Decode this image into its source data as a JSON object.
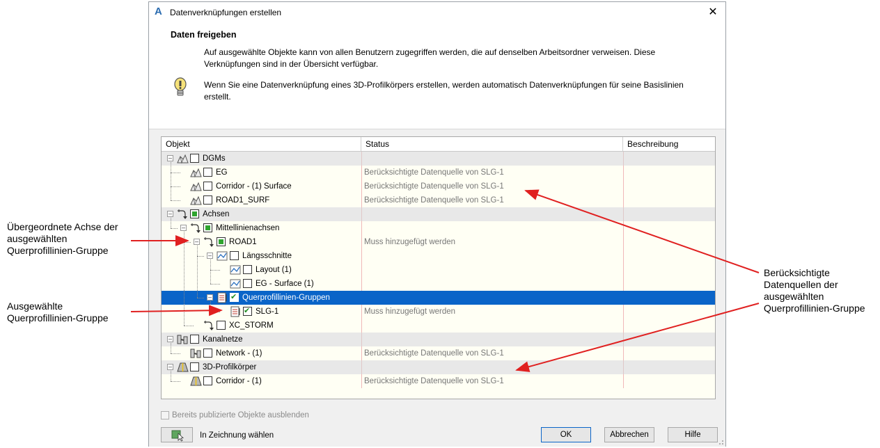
{
  "dialog": {
    "title": "Datenverknüpfungen erstellen",
    "section_title": "Daten freigeben",
    "description": "Auf ausgewählte Objekte kann von allen Benutzern zugegriffen werden, die auf denselben Arbeitsordner verweisen. Diese Verknüpfungen sind in der Übersicht verfügbar.",
    "tip": "Wenn Sie eine Datenverknüpfung eines 3D-Profilkörpers erstellen, werden automatisch Datenverknüpfungen für seine Basislinien erstellt."
  },
  "grid": {
    "columns": [
      "Objekt",
      "Status",
      "Beschreibung"
    ],
    "rows": [
      {
        "label": "DGMs",
        "status": "",
        "group": true,
        "level": 0,
        "icon": "surface-icon",
        "check": "none",
        "expander": "minus"
      },
      {
        "label": "EG",
        "status": "Berücksichtigte Datenquelle von SLG-1",
        "level": 1,
        "icon": "surface-icon",
        "check": "none"
      },
      {
        "label": "Corridor - (1) Surface",
        "status": "Berücksichtigte Datenquelle von SLG-1",
        "level": 1,
        "icon": "surface-icon",
        "check": "none"
      },
      {
        "label": "ROAD1_SURF",
        "status": "Berücksichtigte Datenquelle von SLG-1",
        "level": 1,
        "icon": "surface-icon",
        "check": "none"
      },
      {
        "label": "Achsen",
        "status": "",
        "group": true,
        "level": 0,
        "icon": "alignment-icon",
        "check": "partial",
        "expander": "minus"
      },
      {
        "label": "Mittellinienachsen",
        "status": "",
        "level": 1,
        "icon": "alignment-icon",
        "check": "partial",
        "expander": "minus"
      },
      {
        "label": "ROAD1",
        "status": "Muss hinzugefügt werden",
        "level": 2,
        "icon": "alignment-icon",
        "check": "partial",
        "expander": "minus"
      },
      {
        "label": "Längsschnitte",
        "status": "",
        "level": 3,
        "icon": "profile-icon",
        "check": "none",
        "expander": "minus"
      },
      {
        "label": "Layout (1)",
        "status": "",
        "level": 4,
        "icon": "profile-icon",
        "check": "none"
      },
      {
        "label": "EG - Surface (1)",
        "status": "",
        "level": 4,
        "icon": "profile-icon",
        "check": "none"
      },
      {
        "label": "Querprofillinien-Gruppen",
        "status": "",
        "level": 3,
        "icon": "sample-line-group-icon",
        "check": "checked",
        "expander": "minus",
        "selected": true
      },
      {
        "label": "SLG-1",
        "status": "Muss hinzugefügt werden",
        "level": 4,
        "icon": "sample-line-group-icon",
        "check": "checked"
      },
      {
        "label": "XC_STORM",
        "status": "",
        "level": 2,
        "icon": "alignment-icon",
        "check": "none"
      },
      {
        "label": "Kanalnetze",
        "status": "",
        "group": true,
        "level": 0,
        "icon": "pipe-network-icon",
        "check": "none",
        "expander": "minus"
      },
      {
        "label": "Network - (1)",
        "status": "Berücksichtigte Datenquelle von SLG-1",
        "level": 1,
        "icon": "pipe-network-icon",
        "check": "none"
      },
      {
        "label": "3D-Profilkörper",
        "status": "",
        "group": true,
        "level": 0,
        "icon": "corridor-icon",
        "check": "none",
        "expander": "minus"
      },
      {
        "label": "Corridor - (1)",
        "status": "Berücksichtigte Datenquelle von SLG-1",
        "level": 1,
        "icon": "corridor-icon",
        "check": "none"
      }
    ]
  },
  "footer": {
    "hide_published_label": "Bereits publizierte Objekte ausblenden",
    "pick_in_drawing_label": "In Zeichnung wählen",
    "ok_label": "OK",
    "cancel_label": "Abbrechen",
    "help_label": "Hilfe"
  },
  "annotations": {
    "parent_alignment": [
      "Übergeordnete Achse der",
      "ausgewählten",
      "Querprofillinien-Gruppe"
    ],
    "selected_group": [
      "Ausgewählte",
      "Querprofillinien-Gruppe"
    ],
    "considered_sources": [
      "Berücksichtigte",
      "Datenquellen der",
      "ausgewählten",
      "Querprofillinien-Gruppe"
    ]
  },
  "colors": {
    "selection": "#0a64c8",
    "annotation_arrow": "#e02020",
    "grid_background": "#fffff4"
  }
}
